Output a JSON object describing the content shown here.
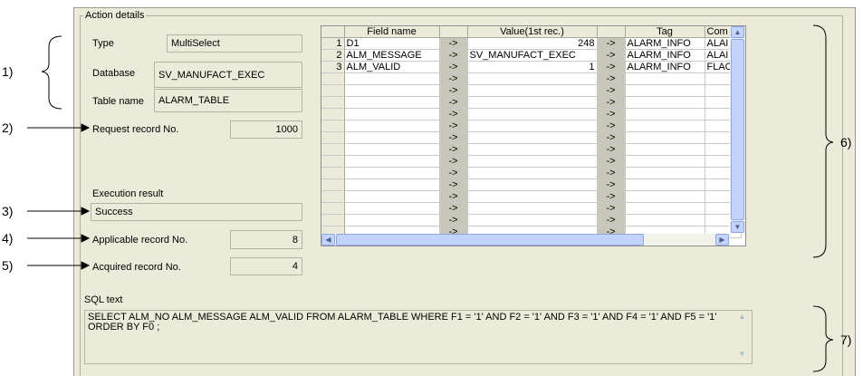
{
  "group_title": "Action details",
  "type": {
    "label": "Type",
    "value": "MultiSelect"
  },
  "database": {
    "label": "Database",
    "value": "SV_MANUFACT_EXEC"
  },
  "table_name": {
    "label": "Table name",
    "value": "ALARM_TABLE"
  },
  "request_record": {
    "label": "Request record No.",
    "value": "1000"
  },
  "execution_result": {
    "label": "Execution result",
    "value": "Success"
  },
  "applicable_record": {
    "label": "Applicable record No.",
    "value": "8"
  },
  "acquired_record": {
    "label": "Acquired record No.",
    "value": "4"
  },
  "sql": {
    "label": "SQL text",
    "value": "SELECT ALM_NO ALM_MESSAGE ALM_VALID FROM ALARM_TABLE  WHERE F1 = '1' AND F2 = '1' AND F3 = '1' AND F4 = '1' AND F5 = '1' ORDER BY F0 ;"
  },
  "grid": {
    "columns": [
      "",
      "Field name",
      "",
      "Value(1st rec.)",
      "",
      "Tag",
      "Com"
    ],
    "rows": [
      [
        "1",
        "D1",
        "->",
        "248",
        "->",
        "ALARM_INFO",
        "ALAI"
      ],
      [
        "2",
        "ALM_MESSAGE",
        "->",
        "SV_MANUFACT_EXEC",
        "->",
        "ALARM_INFO",
        "ALAI"
      ],
      [
        "3",
        "ALM_VALID",
        "->",
        "1",
        "->",
        "ALARM_INFO",
        "FLAC"
      ],
      [
        "",
        "",
        "->",
        "",
        "->",
        "",
        ""
      ],
      [
        "",
        "",
        "->",
        "",
        "->",
        "",
        ""
      ],
      [
        "",
        "",
        "->",
        "",
        "->",
        "",
        ""
      ],
      [
        "",
        "",
        "->",
        "",
        "->",
        "",
        ""
      ],
      [
        "",
        "",
        "->",
        "",
        "->",
        "",
        ""
      ],
      [
        "",
        "",
        "->",
        "",
        "->",
        "",
        ""
      ],
      [
        "",
        "",
        "->",
        "",
        "->",
        "",
        ""
      ],
      [
        "",
        "",
        "->",
        "",
        "->",
        "",
        ""
      ],
      [
        "",
        "",
        "->",
        "",
        "->",
        "",
        ""
      ],
      [
        "",
        "",
        "->",
        "",
        "->",
        "",
        ""
      ],
      [
        "",
        "",
        "->",
        "",
        "->",
        "",
        ""
      ],
      [
        "",
        "",
        "->",
        "",
        "->",
        "",
        ""
      ],
      [
        "",
        "",
        "->",
        "",
        "->",
        "",
        ""
      ],
      [
        "",
        "",
        "->",
        "",
        "->",
        "",
        ""
      ]
    ]
  },
  "callouts": [
    "1)",
    "2)",
    "3)",
    "4)",
    "5)",
    "6)",
    "7)"
  ],
  "icons": {
    "scroll_up": "scroll-up-arrow",
    "scroll_down": "scroll-down-arrow",
    "scroll_left": "scroll-left-arrow",
    "scroll_right": "scroll-right-arrow"
  }
}
